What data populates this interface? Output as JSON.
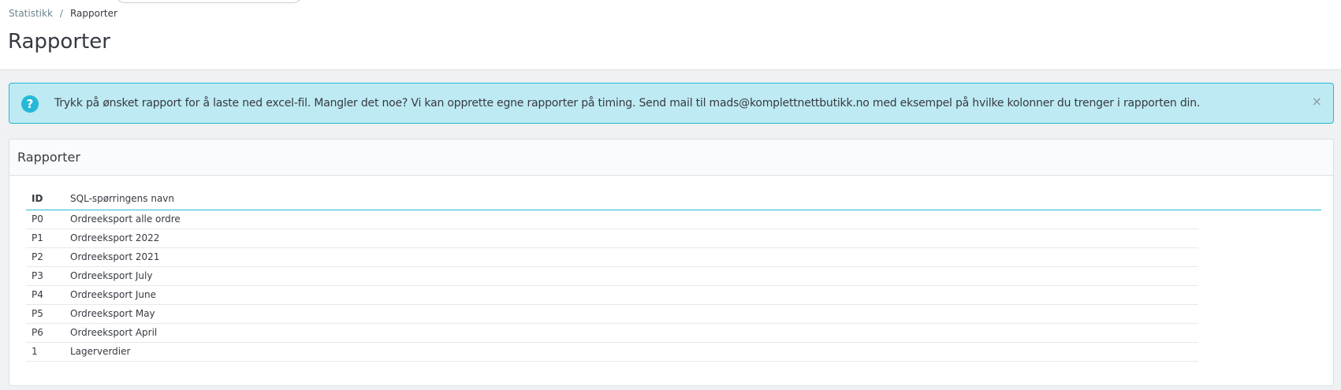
{
  "breadcrumb": {
    "parent": "Statistikk",
    "separator": "/",
    "current": "Rapporter"
  },
  "page": {
    "title": "Rapporter"
  },
  "alert": {
    "icon": "question-circle-icon",
    "icon_glyph": "?",
    "text": "Trykk på ønsket rapport for å laste ned excel-fil. Mangler det noe? Vi kan opprette egne rapporter på timing. Send mail til mads@komplettnettbutikk.no med eksempel på hvilke kolonner du trenger i rapporten din.",
    "close_glyph": "×"
  },
  "card": {
    "title": "Rapporter",
    "columns": {
      "id": "ID",
      "name": "SQL-spørringens navn"
    },
    "rows": [
      {
        "id": "P0",
        "name": "Ordreeksport alle ordre"
      },
      {
        "id": "P1",
        "name": "Ordreeksport 2022"
      },
      {
        "id": "P2",
        "name": "Ordreeksport 2021"
      },
      {
        "id": "P3",
        "name": "Ordreeksport July"
      },
      {
        "id": "P4",
        "name": "Ordreeksport June"
      },
      {
        "id": "P5",
        "name": "Ordreeksport May"
      },
      {
        "id": "P6",
        "name": "Ordreeksport April"
      },
      {
        "id": "1",
        "name": "Lagerverdier"
      }
    ]
  },
  "colors": {
    "accent": "#25b9d7",
    "alert_bg": "#beeaf3",
    "text": "#363a41",
    "muted": "#6c868e"
  }
}
